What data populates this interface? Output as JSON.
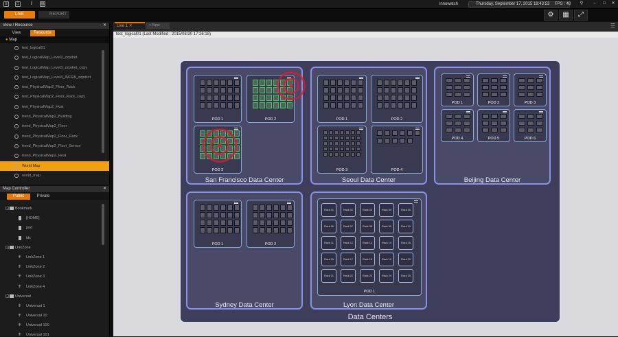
{
  "app": {
    "user": "innowatch",
    "datetime": "Thursday, September 17, 2015 18:43:53",
    "fps": "FPS : 40",
    "mode_live": "LIVE",
    "mode_report": "REPORT"
  },
  "left": {
    "view_panel_title": "View / Resource",
    "tabs": [
      "View",
      "Resource"
    ],
    "tree_root": "Map",
    "items": [
      "test_logical01",
      "test_LogicalMap_Level2_zzpdrot",
      "test_LogicalMap_Level3_zzpdrot_copy",
      "test_LogicalMap_Level4_INFRA_zzpdrot",
      "test_PhysicalMap2_Floor_Rack",
      "test_PhysicalMap2_Floor_Rack_copy",
      "test_PhysicalMap2_Host",
      "trend_PhysicalMap2_Building",
      "trend_PhysicalMap2_Floor",
      "trend_PhysicalMap2_Floor_Rack",
      "trend_PhysicalMap2_Floor_Sensor",
      "trend_PhysicalMap2_Host",
      "World Map",
      "world_map"
    ],
    "selected_index": 12,
    "map_controller_title": "Map Controller",
    "mc_tabs": [
      "Public",
      "Private"
    ],
    "mc_items": [
      {
        "label": "Bookmark",
        "type": "folder",
        "level": 0
      },
      {
        "label": "[HOME]",
        "type": "bookmark",
        "level": 1
      },
      {
        "label": "pod",
        "type": "bookmark",
        "level": 1
      },
      {
        "label": "idc",
        "type": "bookmark",
        "level": 1
      },
      {
        "label": "LinkZone",
        "type": "folder",
        "level": 0
      },
      {
        "label": "LinkZone 1",
        "type": "zone",
        "level": 1
      },
      {
        "label": "LinkZone 2",
        "type": "zone",
        "level": 1
      },
      {
        "label": "LinkZone 3",
        "type": "zone",
        "level": 1
      },
      {
        "label": "LinkZone 4",
        "type": "zone",
        "level": 1
      },
      {
        "label": "Universal",
        "type": "folder",
        "level": 0
      },
      {
        "label": "Universal 1",
        "type": "zone",
        "level": 1
      },
      {
        "label": "Universal 10",
        "type": "zone",
        "level": 1
      },
      {
        "label": "Universal 100",
        "type": "zone",
        "level": 1
      },
      {
        "label": "Universal 101",
        "type": "zone",
        "level": 1
      }
    ]
  },
  "document": {
    "tab": "Live 1",
    "new_tab": "+ New",
    "title": "test_logical01 (Last Modified : 2015/08/30 17:26:18)"
  },
  "map": {
    "title": "Data Centers",
    "centers": {
      "sf": {
        "name": "San Francisco Data Center",
        "pods": [
          "POD 1",
          "POD 2",
          "POD 3"
        ]
      },
      "seoul": {
        "name": "Seoul Data Center",
        "pods": [
          "POD 1",
          "POD 2",
          "POD 3",
          "POD 4"
        ]
      },
      "beijing": {
        "name": "Beijing Data Center",
        "pods": [
          "POD 1",
          "POD 2",
          "POD 3",
          "POD 4",
          "POD 5",
          "POD 6"
        ]
      },
      "sydney": {
        "name": "Sydney Data Center",
        "pods": [
          "POD 1",
          "POD 2"
        ]
      },
      "lyon": {
        "name": "Lyon Data Center",
        "pods": [
          "POD 1"
        ],
        "racks": [
          "Rack 01",
          "Rack 02",
          "Rack 03",
          "Rack 04",
          "Rack 05",
          "Rack 06",
          "Rack 07",
          "Rack 08",
          "Rack 09",
          "Rack 10",
          "Rack 11",
          "Rack 12",
          "Rack 13",
          "Rack 14",
          "Rack 15",
          "Rack 16",
          "Rack 17",
          "Rack 18",
          "Rack 19",
          "Rack 20",
          "Rack 21",
          "Rack 22",
          "Rack 23",
          "Rack 24",
          "Rack 25"
        ]
      }
    },
    "alert_color": "#d61e32",
    "ok_color": "#3dcc4a",
    "border_color": "#8a92e8"
  }
}
